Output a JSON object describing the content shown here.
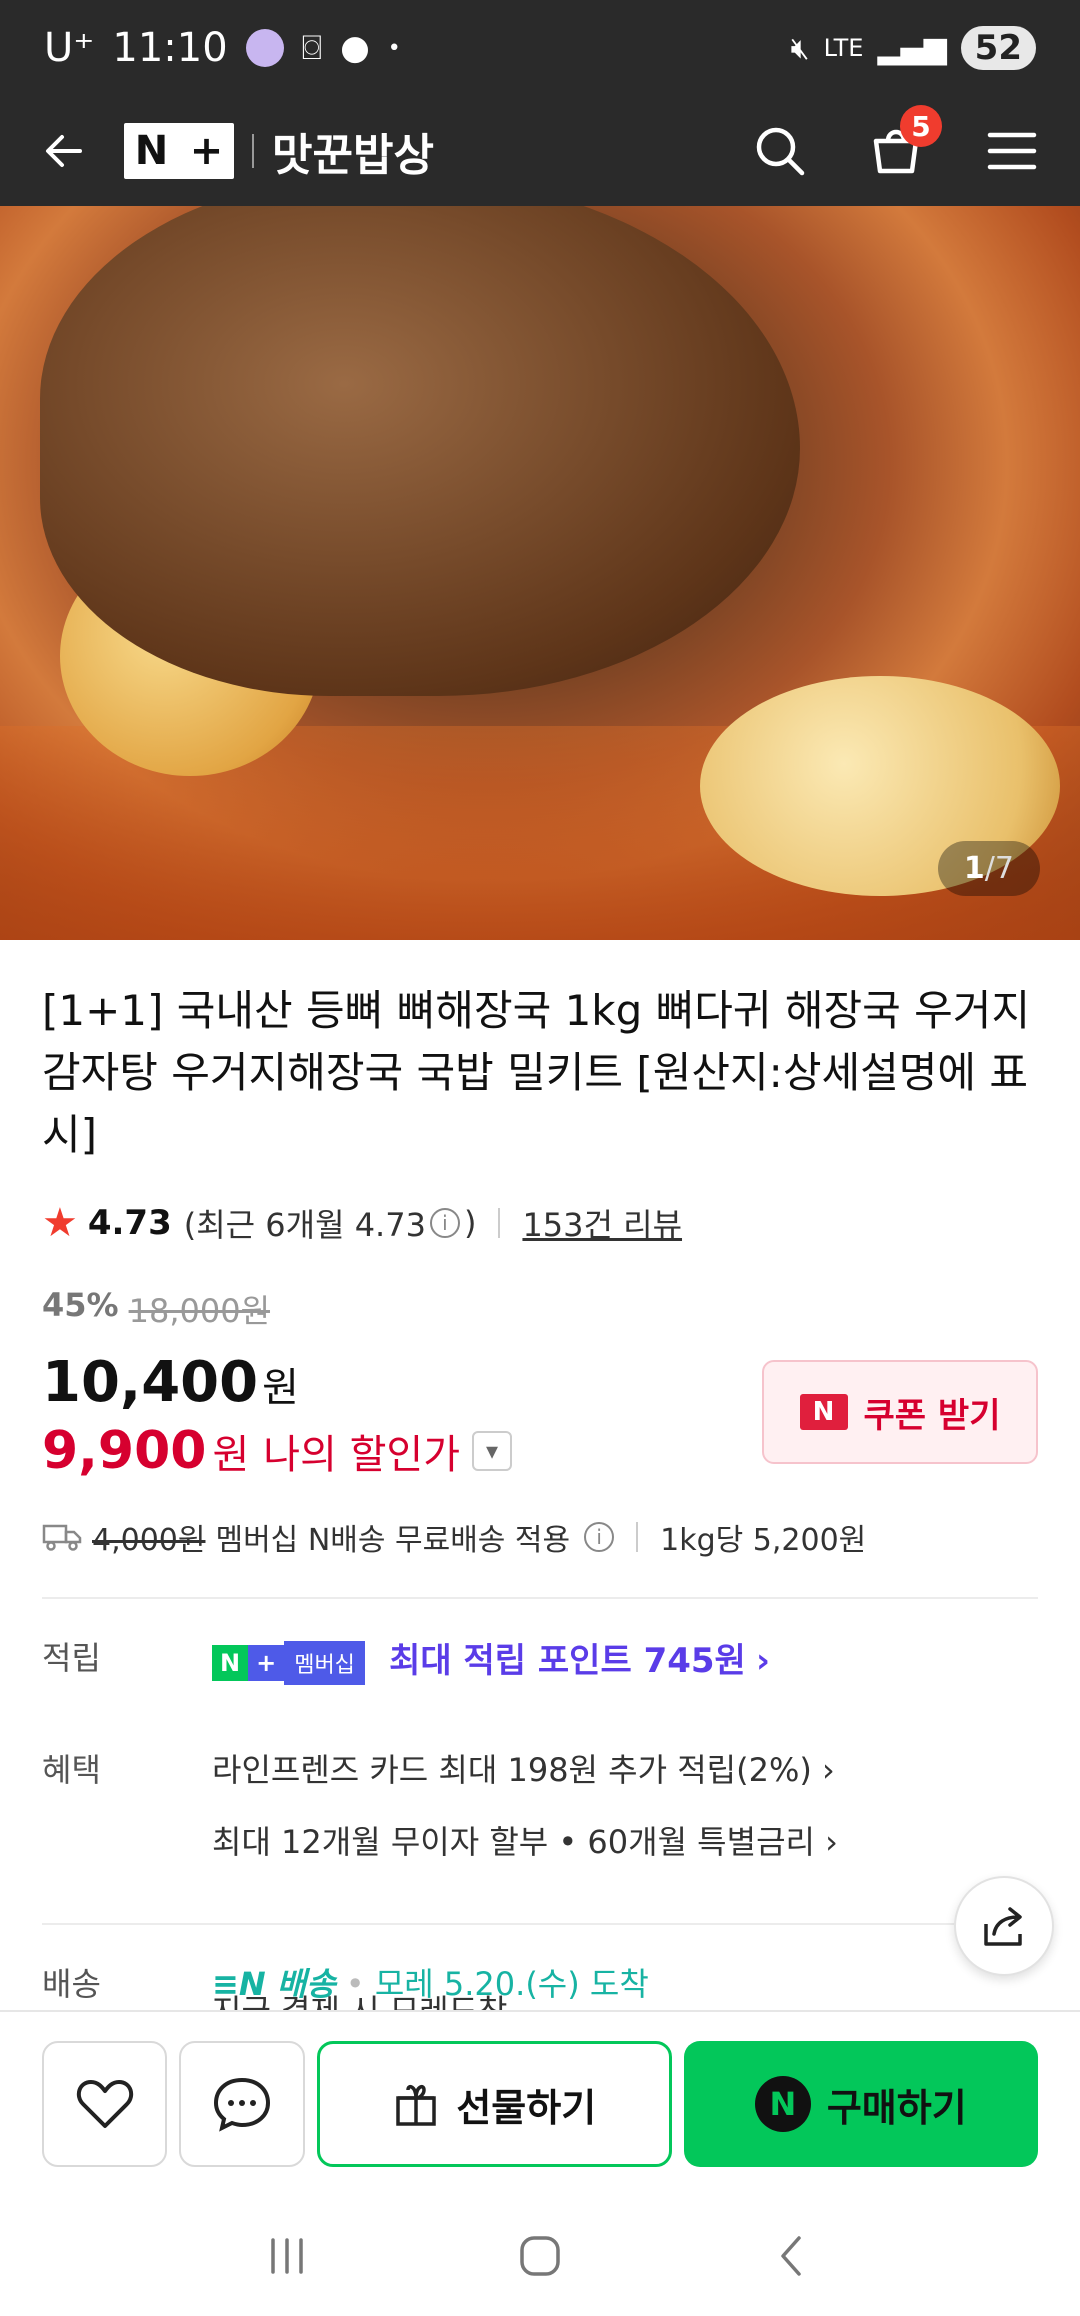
{
  "status_bar": {
    "carrier": "U⁺",
    "time": "11:10",
    "network": "LTE",
    "battery": "52"
  },
  "app_bar": {
    "logo_text": "N+",
    "store_name": "맛꾼밥상",
    "cart_count": "5"
  },
  "gallery": {
    "current": "1",
    "total": "/7"
  },
  "product": {
    "title": "[1+1] 국내산 등뼈 뼈해장국 1kg 뼈다귀 해장국 우거지 감자탕 우거지해장국 국밥 밀키트 [원산지:상세설명에 표시]",
    "rating": "4.73",
    "recent_rating_prefix": "(최근 6개월 4.73",
    "recent_rating_suffix": ")",
    "review_count": "153건 리뷰",
    "discount_rate": "45%",
    "original_price": "18,000원",
    "price": "10,400",
    "price_unit": "원",
    "my_price": "9,900",
    "my_price_unit": "원",
    "my_price_label": "나의 할인가",
    "coupon_label": "쿠폰 받기",
    "coupon_icon": "N"
  },
  "shipping": {
    "old_fee": "4,000원",
    "fee_text": "멤버십 N배송 무료배송 적용",
    "unit_price": "1kg당 5,200원"
  },
  "info": {
    "points_label": "적립",
    "membership_badge": "멤버십",
    "points_text": "최대 적립 포인트 745원",
    "benefit_label": "혜택",
    "benefit_1": "라인프렌즈 카드 최대 198원 추가 적립(2%)",
    "benefit_2": "최대 12개월 무이자 할부 • 60개월 특별금리",
    "delivery_label": "배송",
    "delivery_brand": "배송",
    "delivery_date": "모레 5.20.(수) 도착",
    "delivery_sub": "지금 결제 시 모레도착"
  },
  "bottom_bar": {
    "gift_label": "선물하기",
    "buy_label": "구매하기"
  },
  "colors": {
    "accent_green": "#03c75a",
    "sale_red": "#d6002f",
    "membership_purple": "#5a3ce8",
    "delivery_teal": "#17b3a3"
  }
}
